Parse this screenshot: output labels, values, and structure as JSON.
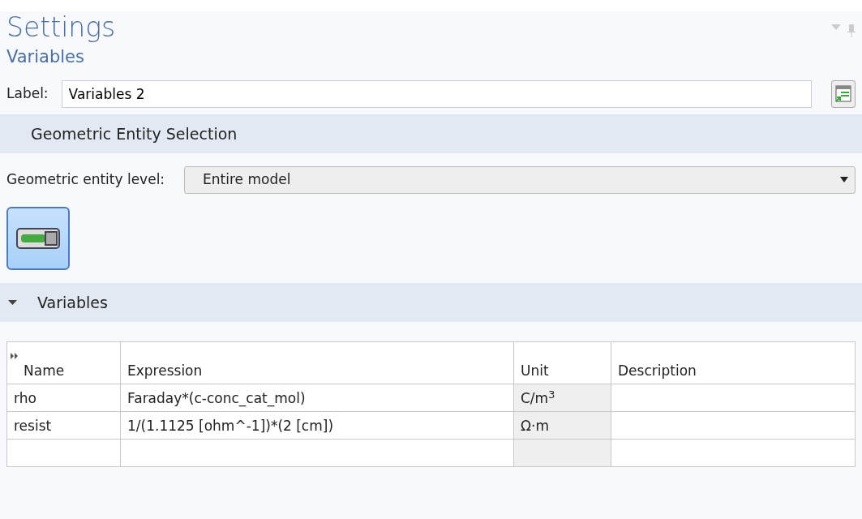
{
  "panel": {
    "title": "Settings",
    "subtitle": "Variables"
  },
  "label_field": {
    "label": "Label:",
    "value": "Variables 2"
  },
  "geometric_section": {
    "title": "Geometric Entity Selection",
    "level_label": "Geometric entity level:",
    "level_value": "Entire model",
    "active_toggle": {
      "pressed": true
    }
  },
  "variables_section": {
    "title": "Variables",
    "expanded": true
  },
  "table": {
    "columns": [
      "Name",
      "Expression",
      "Unit",
      "Description"
    ],
    "rows": [
      {
        "name": "rho",
        "expression": "Faraday*(c-conc_cat_mol)",
        "unit": "C/m$^{3}$",
        "description": ""
      },
      {
        "name": "resist",
        "expression": "1/(1.1125 [ohm^-1])*(2 [cm])",
        "unit": "Ω·m",
        "description": ""
      },
      {
        "name": "",
        "expression": "",
        "unit": "",
        "description": ""
      }
    ]
  }
}
